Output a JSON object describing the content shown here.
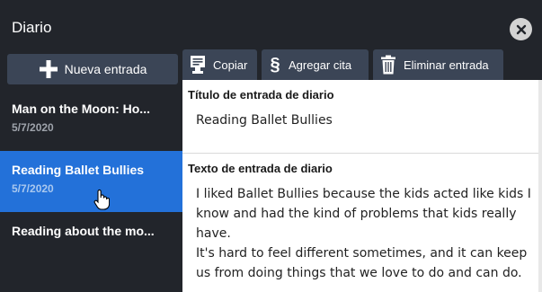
{
  "window": {
    "title": "Diario"
  },
  "sidebar": {
    "new_entry_label": "Nueva entrada",
    "entries": [
      {
        "title": "Man on the Moon: Ho...",
        "date": "5/7/2020"
      },
      {
        "title": "Reading Ballet Bullies",
        "date": "5/7/2020"
      },
      {
        "title": "Reading about the mo...",
        "date": ""
      }
    ]
  },
  "toolbar": {
    "copy_label": "Copiar",
    "cite_label": "Agregar cita",
    "delete_label": "Eliminar entrada"
  },
  "editor": {
    "title_label": "Título de entrada de diario",
    "title_value": "Reading Ballet Bullies",
    "text_label": "Texto de entrada de diario",
    "paragraph_1": "I liked Ballet Bullies because the kids acted like kids I know and had the kind of problems that kids really have.",
    "paragraph_2": "It's hard to feel different sometimes, and it can keep us from doing things that we love to do and can do."
  },
  "colors": {
    "background": "#22252b",
    "button": "#3b4556",
    "selected": "#2371d9"
  }
}
